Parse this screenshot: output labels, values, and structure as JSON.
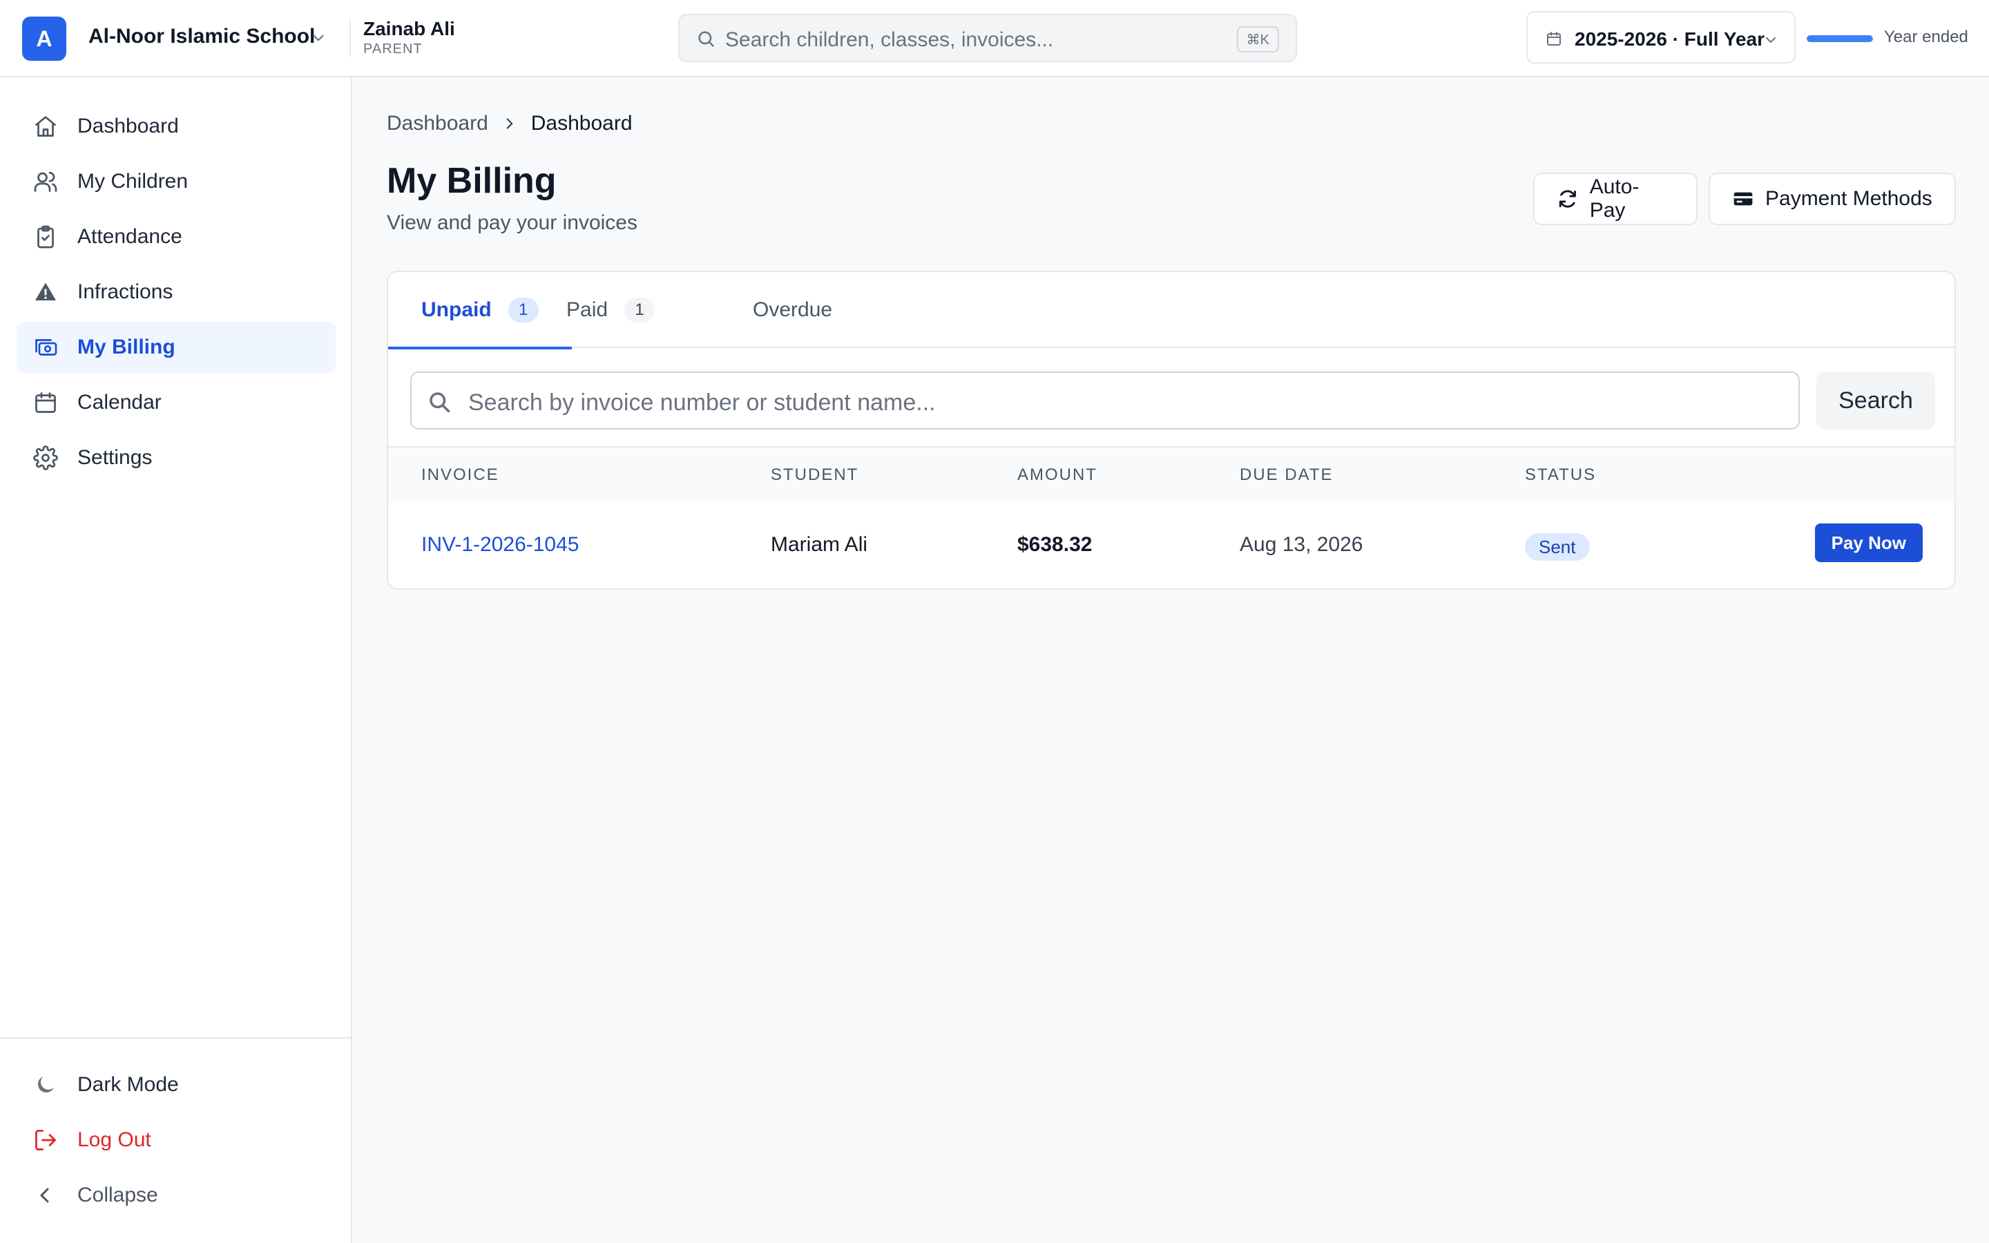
{
  "header": {
    "logo_letter": "A",
    "school_name": "Al-Noor Islamic School",
    "user_name": "Zainab Ali",
    "user_role": "PARENT",
    "search_placeholder": "Search children, classes, invoices...",
    "search_shortcut": "⌘K",
    "year_label": "2025-2026 · Full Year",
    "year_progress_percent": 100,
    "year_status": "Year ended",
    "accent_color": "#2563eb"
  },
  "sidebar": {
    "items": [
      {
        "label": "Dashboard",
        "icon": "home-icon"
      },
      {
        "label": "My Children",
        "icon": "users-icon"
      },
      {
        "label": "Attendance",
        "icon": "clipboard-check-icon"
      },
      {
        "label": "Infractions",
        "icon": "warning-icon"
      },
      {
        "label": "My Billing",
        "icon": "billing-icon",
        "active": true
      },
      {
        "label": "Calendar",
        "icon": "calendar-icon"
      },
      {
        "label": "Settings",
        "icon": "gear-icon"
      }
    ],
    "footer": {
      "dark_mode": "Dark Mode",
      "logout": "Log Out",
      "collapse": "Collapse"
    }
  },
  "main": {
    "breadcrumb": [
      "Dashboard",
      "Dashboard"
    ],
    "title": "My Billing",
    "subtitle": "View and pay your invoices",
    "actions": {
      "autopay": "Auto-Pay",
      "payment_methods": "Payment Methods"
    },
    "tabs": [
      {
        "label": "Unpaid",
        "count": "1",
        "active": true
      },
      {
        "label": "Paid",
        "count": "1"
      },
      {
        "label": "Overdue"
      }
    ],
    "search": {
      "placeholder": "Search by invoice number or student name...",
      "button": "Search"
    },
    "table": {
      "columns": [
        "INVOICE",
        "STUDENT",
        "AMOUNT",
        "DUE DATE",
        "STATUS"
      ],
      "rows": [
        {
          "invoice": "INV-1-2026-1045",
          "student": "Mariam Ali",
          "amount": "$638.32",
          "due_date": "Aug 13, 2026",
          "status": "Sent",
          "action": "Pay Now"
        }
      ]
    }
  }
}
